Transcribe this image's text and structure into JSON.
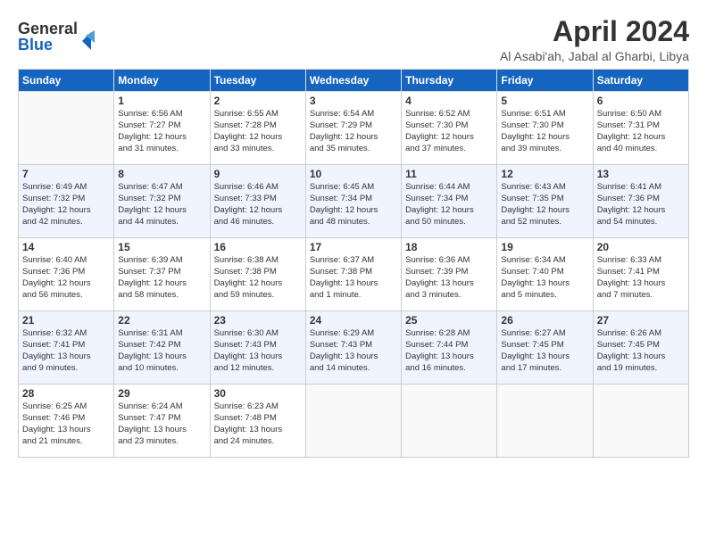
{
  "logo": {
    "line1": "General",
    "line2": "Blue"
  },
  "title": "April 2024",
  "location": "Al Asabi'ah, Jabal al Gharbi, Libya",
  "days_of_week": [
    "Sunday",
    "Monday",
    "Tuesday",
    "Wednesday",
    "Thursday",
    "Friday",
    "Saturday"
  ],
  "weeks": [
    [
      {
        "day": "",
        "info": ""
      },
      {
        "day": "1",
        "info": "Sunrise: 6:56 AM\nSunset: 7:27 PM\nDaylight: 12 hours\nand 31 minutes."
      },
      {
        "day": "2",
        "info": "Sunrise: 6:55 AM\nSunset: 7:28 PM\nDaylight: 12 hours\nand 33 minutes."
      },
      {
        "day": "3",
        "info": "Sunrise: 6:54 AM\nSunset: 7:29 PM\nDaylight: 12 hours\nand 35 minutes."
      },
      {
        "day": "4",
        "info": "Sunrise: 6:52 AM\nSunset: 7:30 PM\nDaylight: 12 hours\nand 37 minutes."
      },
      {
        "day": "5",
        "info": "Sunrise: 6:51 AM\nSunset: 7:30 PM\nDaylight: 12 hours\nand 39 minutes."
      },
      {
        "day": "6",
        "info": "Sunrise: 6:50 AM\nSunset: 7:31 PM\nDaylight: 12 hours\nand 40 minutes."
      }
    ],
    [
      {
        "day": "7",
        "info": "Sunrise: 6:49 AM\nSunset: 7:32 PM\nDaylight: 12 hours\nand 42 minutes."
      },
      {
        "day": "8",
        "info": "Sunrise: 6:47 AM\nSunset: 7:32 PM\nDaylight: 12 hours\nand 44 minutes."
      },
      {
        "day": "9",
        "info": "Sunrise: 6:46 AM\nSunset: 7:33 PM\nDaylight: 12 hours\nand 46 minutes."
      },
      {
        "day": "10",
        "info": "Sunrise: 6:45 AM\nSunset: 7:34 PM\nDaylight: 12 hours\nand 48 minutes."
      },
      {
        "day": "11",
        "info": "Sunrise: 6:44 AM\nSunset: 7:34 PM\nDaylight: 12 hours\nand 50 minutes."
      },
      {
        "day": "12",
        "info": "Sunrise: 6:43 AM\nSunset: 7:35 PM\nDaylight: 12 hours\nand 52 minutes."
      },
      {
        "day": "13",
        "info": "Sunrise: 6:41 AM\nSunset: 7:36 PM\nDaylight: 12 hours\nand 54 minutes."
      }
    ],
    [
      {
        "day": "14",
        "info": "Sunrise: 6:40 AM\nSunset: 7:36 PM\nDaylight: 12 hours\nand 56 minutes."
      },
      {
        "day": "15",
        "info": "Sunrise: 6:39 AM\nSunset: 7:37 PM\nDaylight: 12 hours\nand 58 minutes."
      },
      {
        "day": "16",
        "info": "Sunrise: 6:38 AM\nSunset: 7:38 PM\nDaylight: 12 hours\nand 59 minutes."
      },
      {
        "day": "17",
        "info": "Sunrise: 6:37 AM\nSunset: 7:38 PM\nDaylight: 13 hours\nand 1 minute."
      },
      {
        "day": "18",
        "info": "Sunrise: 6:36 AM\nSunset: 7:39 PM\nDaylight: 13 hours\nand 3 minutes."
      },
      {
        "day": "19",
        "info": "Sunrise: 6:34 AM\nSunset: 7:40 PM\nDaylight: 13 hours\nand 5 minutes."
      },
      {
        "day": "20",
        "info": "Sunrise: 6:33 AM\nSunset: 7:41 PM\nDaylight: 13 hours\nand 7 minutes."
      }
    ],
    [
      {
        "day": "21",
        "info": "Sunrise: 6:32 AM\nSunset: 7:41 PM\nDaylight: 13 hours\nand 9 minutes."
      },
      {
        "day": "22",
        "info": "Sunrise: 6:31 AM\nSunset: 7:42 PM\nDaylight: 13 hours\nand 10 minutes."
      },
      {
        "day": "23",
        "info": "Sunrise: 6:30 AM\nSunset: 7:43 PM\nDaylight: 13 hours\nand 12 minutes."
      },
      {
        "day": "24",
        "info": "Sunrise: 6:29 AM\nSunset: 7:43 PM\nDaylight: 13 hours\nand 14 minutes."
      },
      {
        "day": "25",
        "info": "Sunrise: 6:28 AM\nSunset: 7:44 PM\nDaylight: 13 hours\nand 16 minutes."
      },
      {
        "day": "26",
        "info": "Sunrise: 6:27 AM\nSunset: 7:45 PM\nDaylight: 13 hours\nand 17 minutes."
      },
      {
        "day": "27",
        "info": "Sunrise: 6:26 AM\nSunset: 7:45 PM\nDaylight: 13 hours\nand 19 minutes."
      }
    ],
    [
      {
        "day": "28",
        "info": "Sunrise: 6:25 AM\nSunset: 7:46 PM\nDaylight: 13 hours\nand 21 minutes."
      },
      {
        "day": "29",
        "info": "Sunrise: 6:24 AM\nSunset: 7:47 PM\nDaylight: 13 hours\nand 23 minutes."
      },
      {
        "day": "30",
        "info": "Sunrise: 6:23 AM\nSunset: 7:48 PM\nDaylight: 13 hours\nand 24 minutes."
      },
      {
        "day": "",
        "info": ""
      },
      {
        "day": "",
        "info": ""
      },
      {
        "day": "",
        "info": ""
      },
      {
        "day": "",
        "info": ""
      }
    ]
  ]
}
